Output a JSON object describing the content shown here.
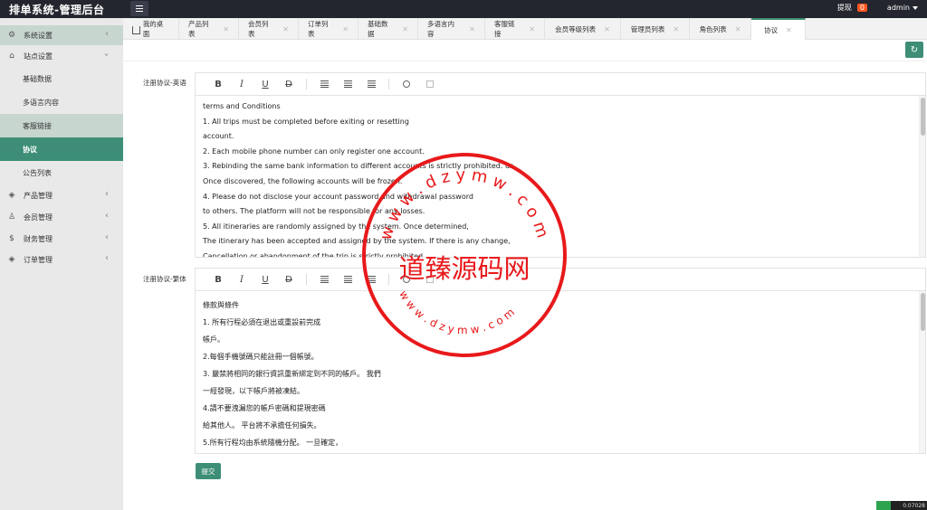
{
  "app": {
    "title": "排单系统-管理后台"
  },
  "header": {
    "withdraw_label": "提现",
    "withdraw_count": "0",
    "user": "admin"
  },
  "sidebar": {
    "items": [
      {
        "label": "系统设置"
      },
      {
        "label": "站点设置"
      },
      {
        "label": "基础数据"
      },
      {
        "label": "多语言内容"
      },
      {
        "label": "客服链接"
      },
      {
        "label": "协议"
      },
      {
        "label": "公告列表"
      },
      {
        "label": "产品管理"
      },
      {
        "label": "会员管理"
      },
      {
        "label": "财务管理"
      },
      {
        "label": "订单管理"
      }
    ]
  },
  "tabs": [
    {
      "label": "我的桌面"
    },
    {
      "label": "产品列表"
    },
    {
      "label": "会员列表"
    },
    {
      "label": "订单列表"
    },
    {
      "label": "基础数据"
    },
    {
      "label": "多语言内容"
    },
    {
      "label": "客服链接"
    },
    {
      "label": "会员等级列表"
    },
    {
      "label": "管理员列表"
    },
    {
      "label": "角色列表"
    },
    {
      "label": "协议"
    }
  ],
  "form": {
    "field_en_label": "注册协议-英语",
    "field_tw_label": "注册协议-繁体",
    "toolbar": {
      "bold": "B",
      "italic": "I",
      "underline": "U",
      "strike": "D"
    },
    "en_lines": [
      "terms and Conditions",
      "1. All trips must be completed before exiting or resetting",
      "account.",
      "2. Each mobile phone number can only register one account.",
      "3. Rebinding the same bank information to different accounts is strictly prohibited. us",
      "Once discovered, the following accounts will be frozen.",
      "4. Please do not disclose your account password and withdrawal password",
      "to others. The platform will not be responsible for any losses.",
      "5. All itineraries are randomly assigned by the system. Once determined,",
      "The itinerary has been accepted and assigned by the system. If there is any change,",
      "Cancellation or abandonment of the trip is strictly prohibited."
    ],
    "tw_lines": [
      "條款與條件",
      "1. 所有行程必須在退出或重設前完成",
      "帳戶。",
      "2.每個手機號碼只能註冊一個帳號。",
      "3. 嚴禁將相同的銀行資訊重新綁定到不同的帳戶。 我們",
      "一經發現，以下帳戶將被凍結。",
      "4.請不要洩漏您的帳戶密碼和提現密碼",
      "給其他人。 平台將不承擔任何損失。",
      "5.所有行程均由系統隨機分配。 一旦確定，"
    ],
    "submit_label": "提交"
  },
  "footer": {
    "badge_text": "0.07028"
  },
  "watermark": {
    "text_main": "道臻源码网",
    "text_top": "w w w . d z y m w . c o m",
    "text_bottom": "w w w . d z y m w . c o m",
    "color": "#e8191b"
  }
}
